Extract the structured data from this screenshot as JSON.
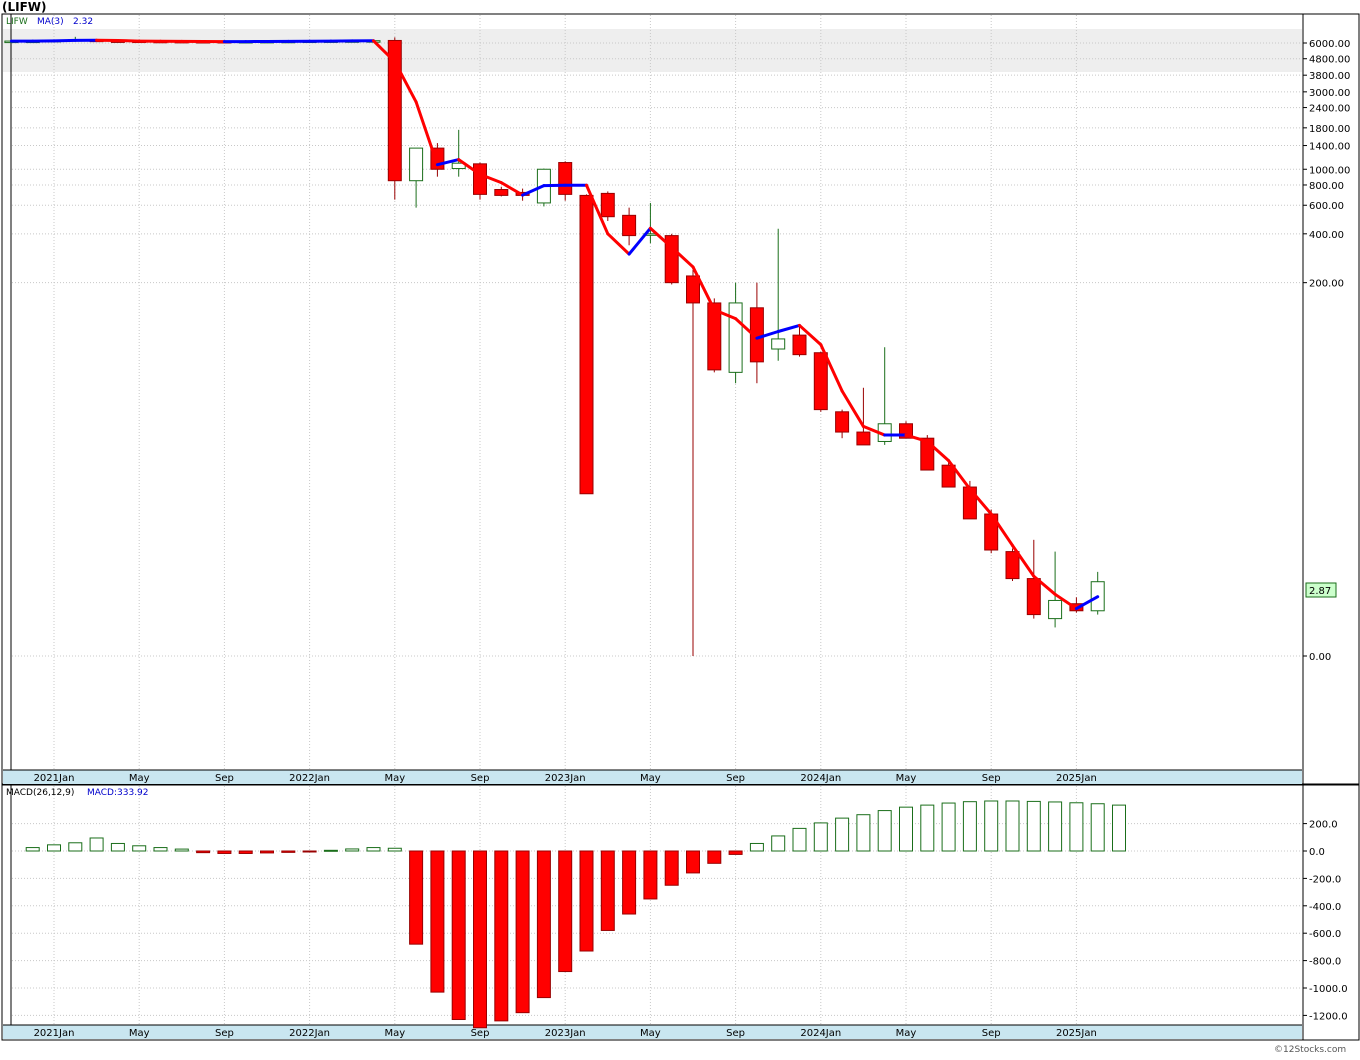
{
  "symbol_label": "(LIFW)",
  "legend": {
    "ticker": "LIFW",
    "ma_label": "MA(3)",
    "ma_value": "2.32"
  },
  "macd_legend": {
    "name": "MACD(26,12,9)",
    "value_label": "MACD:333.92"
  },
  "last_price_label": "2.87",
  "watermark": "©12Stocks.com",
  "colors": {
    "up": "#1a6e1a",
    "down": "#ff0000",
    "ma_up": "#0000ff",
    "ma_down": "#ff0000",
    "axis_band": "#c9e6f0"
  },
  "chart_data": [
    {
      "type": "candlestick",
      "interval": "monthly",
      "scale": "log",
      "x_tick_labels": [
        "2021Jan",
        "May",
        "Sep",
        "2022Jan",
        "May",
        "Sep",
        "2023Jan",
        "May",
        "Sep",
        "2024Jan",
        "May",
        "Sep",
        "2025Jan"
      ],
      "y_tick_labels": [
        "6000.00",
        "4800.00",
        "3800.00",
        "3000.00",
        "2400.00",
        "1800.00",
        "1400.00",
        "1000.00",
        "800.00",
        "600.00",
        "400.00",
        "200.00",
        "0.00"
      ],
      "months": [
        "2020-11",
        "2020-12",
        "2021-01",
        "2021-02",
        "2021-03",
        "2021-04",
        "2021-05",
        "2021-06",
        "2021-07",
        "2021-08",
        "2021-09",
        "2021-10",
        "2021-11",
        "2021-12",
        "2022-01",
        "2022-02",
        "2022-03",
        "2022-04",
        "2022-05",
        "2022-06",
        "2022-07",
        "2022-08",
        "2022-09",
        "2022-10",
        "2022-11",
        "2022-12",
        "2023-01",
        "2023-02",
        "2023-03",
        "2023-04",
        "2023-05",
        "2023-06",
        "2023-07",
        "2023-08",
        "2023-09",
        "2023-10",
        "2023-11",
        "2023-12",
        "2024-01",
        "2024-02",
        "2024-03",
        "2024-04",
        "2024-05",
        "2024-06",
        "2024-07",
        "2024-08",
        "2024-09",
        "2024-10",
        "2024-11",
        "2024-12",
        "2025-01",
        "2025-02"
      ],
      "ohlc": [
        [
          6160,
          6180,
          6150,
          6165
        ],
        [
          6155,
          6175,
          6145,
          6165
        ],
        [
          6160,
          6240,
          6150,
          6230
        ],
        [
          6200,
          6550,
          6180,
          6300
        ],
        [
          6250,
          6280,
          6160,
          6180
        ],
        [
          6180,
          6220,
          6130,
          6160
        ],
        [
          6170,
          6200,
          6120,
          6150
        ],
        [
          6150,
          6180,
          6110,
          6140
        ],
        [
          6140,
          6170,
          6100,
          6130
        ],
        [
          6130,
          6160,
          6090,
          6120
        ],
        [
          6130,
          6160,
          6100,
          6120
        ],
        [
          6125,
          6155,
          6100,
          6130
        ],
        [
          6130,
          6170,
          6110,
          6140
        ],
        [
          6140,
          6180,
          6120,
          6150
        ],
        [
          6150,
          6200,
          6130,
          6170
        ],
        [
          6170,
          6220,
          6150,
          6180
        ],
        [
          6180,
          6230,
          6160,
          6190
        ],
        [
          6190,
          6240,
          6170,
          6200
        ],
        [
          6220,
          6500,
          650,
          850
        ],
        [
          850,
          1150,
          580,
          1350
        ],
        [
          1350,
          1450,
          900,
          1000
        ],
        [
          1010,
          1750,
          900,
          1090
        ],
        [
          1080,
          1100,
          650,
          700
        ],
        [
          750,
          780,
          680,
          690
        ],
        [
          720,
          760,
          640,
          690
        ],
        [
          620,
          1010,
          590,
          1000
        ],
        [
          1100,
          1120,
          640,
          700
        ],
        [
          690,
          700,
          10,
          10
        ],
        [
          710,
          730,
          480,
          510
        ],
        [
          520,
          580,
          340,
          390
        ],
        [
          400,
          620,
          350,
          400
        ],
        [
          390,
          400,
          195,
          200
        ],
        [
          220,
          240,
          1,
          150
        ],
        [
          150,
          160,
          56,
          58
        ],
        [
          56,
          200,
          48,
          150
        ],
        [
          140,
          200,
          48,
          65
        ],
        [
          78,
          430,
          66,
          90
        ],
        [
          95,
          110,
          70,
          72
        ],
        [
          74,
          75,
          32,
          33
        ],
        [
          32,
          33,
          22,
          24
        ],
        [
          24,
          45,
          21,
          20
        ],
        [
          21,
          80,
          20,
          27
        ],
        [
          27,
          28,
          22,
          22
        ],
        [
          22,
          23,
          14,
          14
        ],
        [
          15,
          16,
          11,
          11
        ],
        [
          11,
          12,
          7,
          7
        ],
        [
          7.5,
          8,
          4.3,
          4.5
        ],
        [
          4.4,
          4.6,
          2.9,
          3.0
        ],
        [
          3.0,
          5.2,
          1.7,
          1.8
        ],
        [
          1.7,
          4.4,
          1.5,
          2.2
        ],
        [
          2.1,
          2.3,
          1.85,
          1.9
        ],
        [
          1.9,
          3.3,
          1.8,
          2.87
        ]
      ],
      "ma3": [
        6165,
        6167,
        6187,
        6232,
        6237,
        6213,
        6163,
        6150,
        6140,
        6130,
        6123,
        6123,
        6130,
        6140,
        6153,
        6167,
        6180,
        6190,
        4600,
        2600,
        1067,
        1147,
        930,
        827,
        693,
        793,
        797,
        797,
        400,
        300,
        433,
        330,
        250,
        136,
        120,
        91,
        100,
        109,
        83,
        43,
        26,
        23,
        23,
        21,
        16,
        10.7,
        7.5,
        4.8,
        3.1,
        2.4,
        1.96,
        2.32
      ]
    },
    {
      "type": "histogram",
      "name": "MACD(26,12,9)",
      "y_tick_labels": [
        "200.0",
        "0.0",
        "-200.0",
        "-400.0",
        "-600.0",
        "-800.0",
        "-1000.0",
        "-1200.0"
      ],
      "months_start": "2020-12",
      "values": [
        25,
        45,
        60,
        95,
        55,
        38,
        25,
        14,
        -12,
        -18,
        -18,
        -14,
        -10,
        -5,
        5,
        15,
        25,
        20,
        -680,
        -1030,
        -1230,
        -1290,
        -1240,
        -1180,
        -1070,
        -880,
        -730,
        -580,
        -460,
        -350,
        -250,
        -160,
        -90,
        -25,
        55,
        110,
        165,
        205,
        240,
        265,
        295,
        320,
        335,
        350,
        360,
        365,
        365,
        362,
        358,
        352,
        345,
        335
      ]
    }
  ]
}
